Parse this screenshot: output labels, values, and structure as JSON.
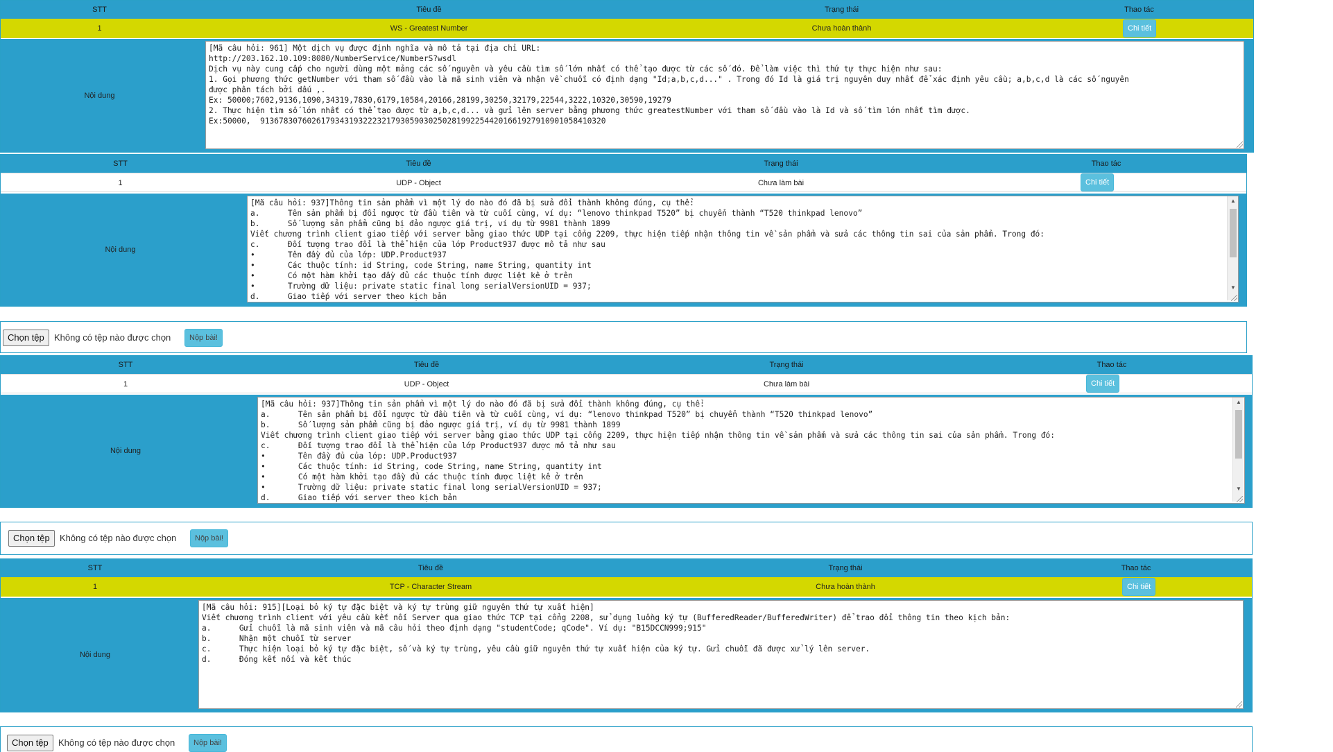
{
  "headers": {
    "stt": "STT",
    "title": "Tiêu đề",
    "status": "Trạng thái",
    "action": "Thao tác"
  },
  "content_label": "Nội dung",
  "detail_label": "Chi tiết",
  "upload": {
    "choose_label": "Chọn tệp",
    "no_file_label": "Không có tệp nào được chọn",
    "submit_label": "Nộp bài!"
  },
  "blocks": [
    {
      "stt": "1",
      "title": "WS - Greatest Number",
      "status": "Chưa hoàn thành",
      "content": "[Mã câu hỏi: 961] Một dịch vụ được định nghĩa và mô tả tại địa chỉ URL:\nhttp://203.162.10.109:8080/NumberService/NumberS?wsdl\nDịch vụ này cung cấp cho người dùng một mảng các số nguyên và yêu cầu tìm số lớn nhất có thể tạo được từ các số đó. Để làm việc thì thứ tự thực hiện như sau:\n1. Gọi phương thức getNumber với tham số đầu vào là mã sinh viên và nhận về chuỗi có định dạng \"Id;a,b,c,d...\" . Trong đó Id là giá trị nguyên duy nhất để xác định yêu cầu; a,b,c,d là các số nguyên\nđược phân tách bởi dấu ,.\nEx: 50000;7602,9136,1090,34319,7830,6179,10584,20166,28199,30250,32179,22544,3222,10320,30590,19279\n2. Thực hiện tìm số lớn nhất có thể tạo được từ a,b,c,d... và gửi lên server bằng phương thức greatestNumber với tham số đầu vào là Id và số tìm lớn nhất tìm được.\nEx:50000,  91367830760261793431932223217930590302502819922544201661927910901058410320"
    },
    {
      "stt": "1",
      "title": "UDP - Object",
      "status": "Chưa làm bài",
      "content": "[Mã câu hỏi: 937]Thông tin sản phẩm vì một lý do nào đó đã bị sửa đổi thành không đúng, cụ thể:\na.      Tên sản phẩm bị đổi ngược từ đầu tiên và từ cuối cùng, ví dụ: “lenovo thinkpad T520” bị chuyển thành “T520 thinkpad lenovo”\nb.      Số lượng sản phẩm cũng bị đảo ngược giá trị, ví dụ từ 9981 thành 1899\nViết chương trình client giao tiếp với server bằng giao thức UDP tại cổng 2209, thực hiện tiếp nhận thông tin về sản phẩm và sửa các thông tin sai của sản phẩm. Trong đó:\nc.      Đối tượng trao đổi là thể hiện của lớp Product937 được mô tả như sau\n•       Tên đầy đủ của lớp: UDP.Product937\n•       Các thuộc tính: id String, code String, name String, quantity int\n•       Có một hàm khởi tạo đầy đủ các thuộc tính được liệt kê ở trên\n•       Trường dữ liệu: private static final long serialVersionUID = 937;\nd.      Giao tiếp với server theo kịch bản"
    },
    {
      "stt": "1",
      "title": "UDP - Object",
      "status": "Chưa làm bài",
      "content": "[Mã câu hỏi: 937]Thông tin sản phẩm vì một lý do nào đó đã bị sửa đổi thành không đúng, cụ thể:\na.      Tên sản phẩm bị đổi ngược từ đầu tiên và từ cuối cùng, ví dụ: “lenovo thinkpad T520” bị chuyển thành “T520 thinkpad lenovo”\nb.      Số lượng sản phẩm cũng bị đảo ngược giá trị, ví dụ từ 9981 thành 1899\nViết chương trình client giao tiếp với server bằng giao thức UDP tại cổng 2209, thực hiện tiếp nhận thông tin về sản phẩm và sửa các thông tin sai của sản phẩm. Trong đó:\nc.      Đối tượng trao đổi là thể hiện của lớp Product937 được mô tả như sau\n•       Tên đầy đủ của lớp: UDP.Product937\n•       Các thuộc tính: id String, code String, name String, quantity int\n•       Có một hàm khởi tạo đầy đủ các thuộc tính được liệt kê ở trên\n•       Trường dữ liệu: private static final long serialVersionUID = 937;\nd.      Giao tiếp với server theo kịch bản"
    },
    {
      "stt": "1",
      "title": "TCP - Character Stream",
      "status": "Chưa hoàn thành",
      "content": "[Mã câu hỏi: 915][Loại bỏ ký tự đặc biệt và ký tự trùng giữ nguyên thứ tự xuất hiện]\nViết chương trình client với yêu cầu kết nối Server qua giao thức TCP tại cổng 2208, sử dụng luồng ký tự (BufferedReader/BufferedWriter) để trao đổi thông tin theo kịch bản:\na.      Gửi chuỗi là mã sinh viên và mã câu hỏi theo định dạng \"studentCode; qCode\". Ví dụ: \"B15DCCN999;915\"\nb.      Nhận một chuỗi từ server\nc.      Thực hiện loại bỏ ký tự đặc biệt, số và ký tự trùng, yêu cầu giữ nguyên thứ tự xuất hiện của ký tự. Gửi chuỗi đã được xử lý lên server.\nd.      Đóng kết nối và kết thúc"
    }
  ]
}
